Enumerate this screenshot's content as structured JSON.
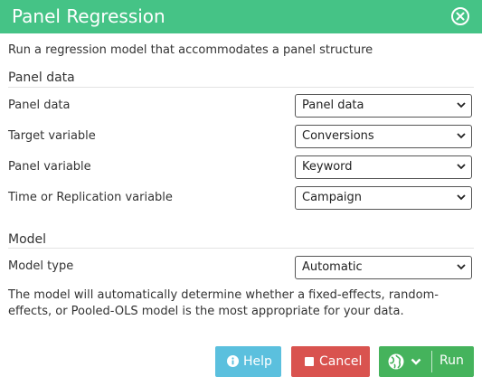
{
  "dialog": {
    "title": "Panel Regression",
    "description": "Run a regression model that accommodates a panel structure"
  },
  "panel_section": {
    "title": "Panel data",
    "rows": [
      {
        "label": "Panel data",
        "value": "Panel data"
      },
      {
        "label": "Target variable",
        "value": "Conversions"
      },
      {
        "label": "Panel variable",
        "value": "Keyword"
      },
      {
        "label": "Time or Replication variable",
        "value": "Campaign"
      }
    ]
  },
  "model_section": {
    "title": "Model",
    "model_type_label": "Model type",
    "model_type_value": "Automatic",
    "note": "The model will automatically determine whether a fixed-effects, random-effects, or Pooled-OLS model is the most appropriate for your data."
  },
  "buttons": {
    "help": "Help",
    "cancel": "Cancel",
    "run": "Run"
  },
  "colors": {
    "header": "#45c386",
    "help": "#5bc0de",
    "cancel": "#d9534f",
    "run": "#45b35c"
  },
  "icons": {
    "close": "close-circle-icon",
    "help": "info-circle-icon",
    "cancel": "stop-square-icon",
    "run_globe": "globe-icon",
    "run_dropdown": "chevron-down-icon",
    "select_chevron": "chevron-down-icon"
  }
}
